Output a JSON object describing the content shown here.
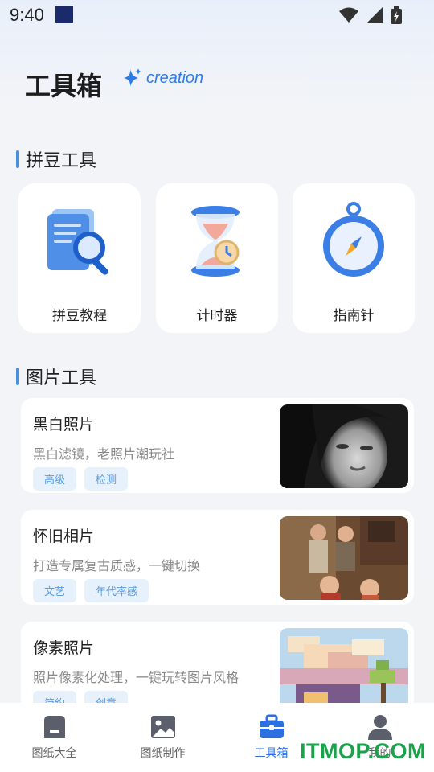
{
  "status_bar": {
    "time": "9:40"
  },
  "header": {
    "title": "工具箱",
    "badge": "creation"
  },
  "sections": {
    "beads": {
      "title": "拼豆工具"
    },
    "images": {
      "title": "图片工具"
    }
  },
  "tools": [
    {
      "label": "拼豆教程",
      "icon": "document-magnifier-icon"
    },
    {
      "label": "计时器",
      "icon": "hourglass-icon"
    },
    {
      "label": "指南针",
      "icon": "compass-icon"
    }
  ],
  "photo_tools": [
    {
      "title": "黑白照片",
      "desc": "黑白滤镜，老照片潮玩社",
      "tags": [
        "高级",
        "检测"
      ]
    },
    {
      "title": "怀旧相片",
      "desc": "打造专属复古质感，一键切换",
      "tags": [
        "文艺",
        "年代率感"
      ]
    },
    {
      "title": "像素照片",
      "desc": "照片像素化处理，一键玩转图片风格",
      "tags": [
        "简约",
        "创意"
      ]
    }
  ],
  "tab_bar": [
    {
      "label": "图纸大全",
      "icon": "drawings-icon"
    },
    {
      "label": "图纸制作",
      "icon": "image-icon"
    },
    {
      "label": "工具箱",
      "icon": "toolbox-icon"
    },
    {
      "label": "我的",
      "icon": "user-icon"
    }
  ],
  "watermark": "ITMOP.COM",
  "colors": {
    "accent": "#2b6fe0",
    "tag_bg": "#e6f1fb",
    "tag_text": "#5a9be0"
  }
}
